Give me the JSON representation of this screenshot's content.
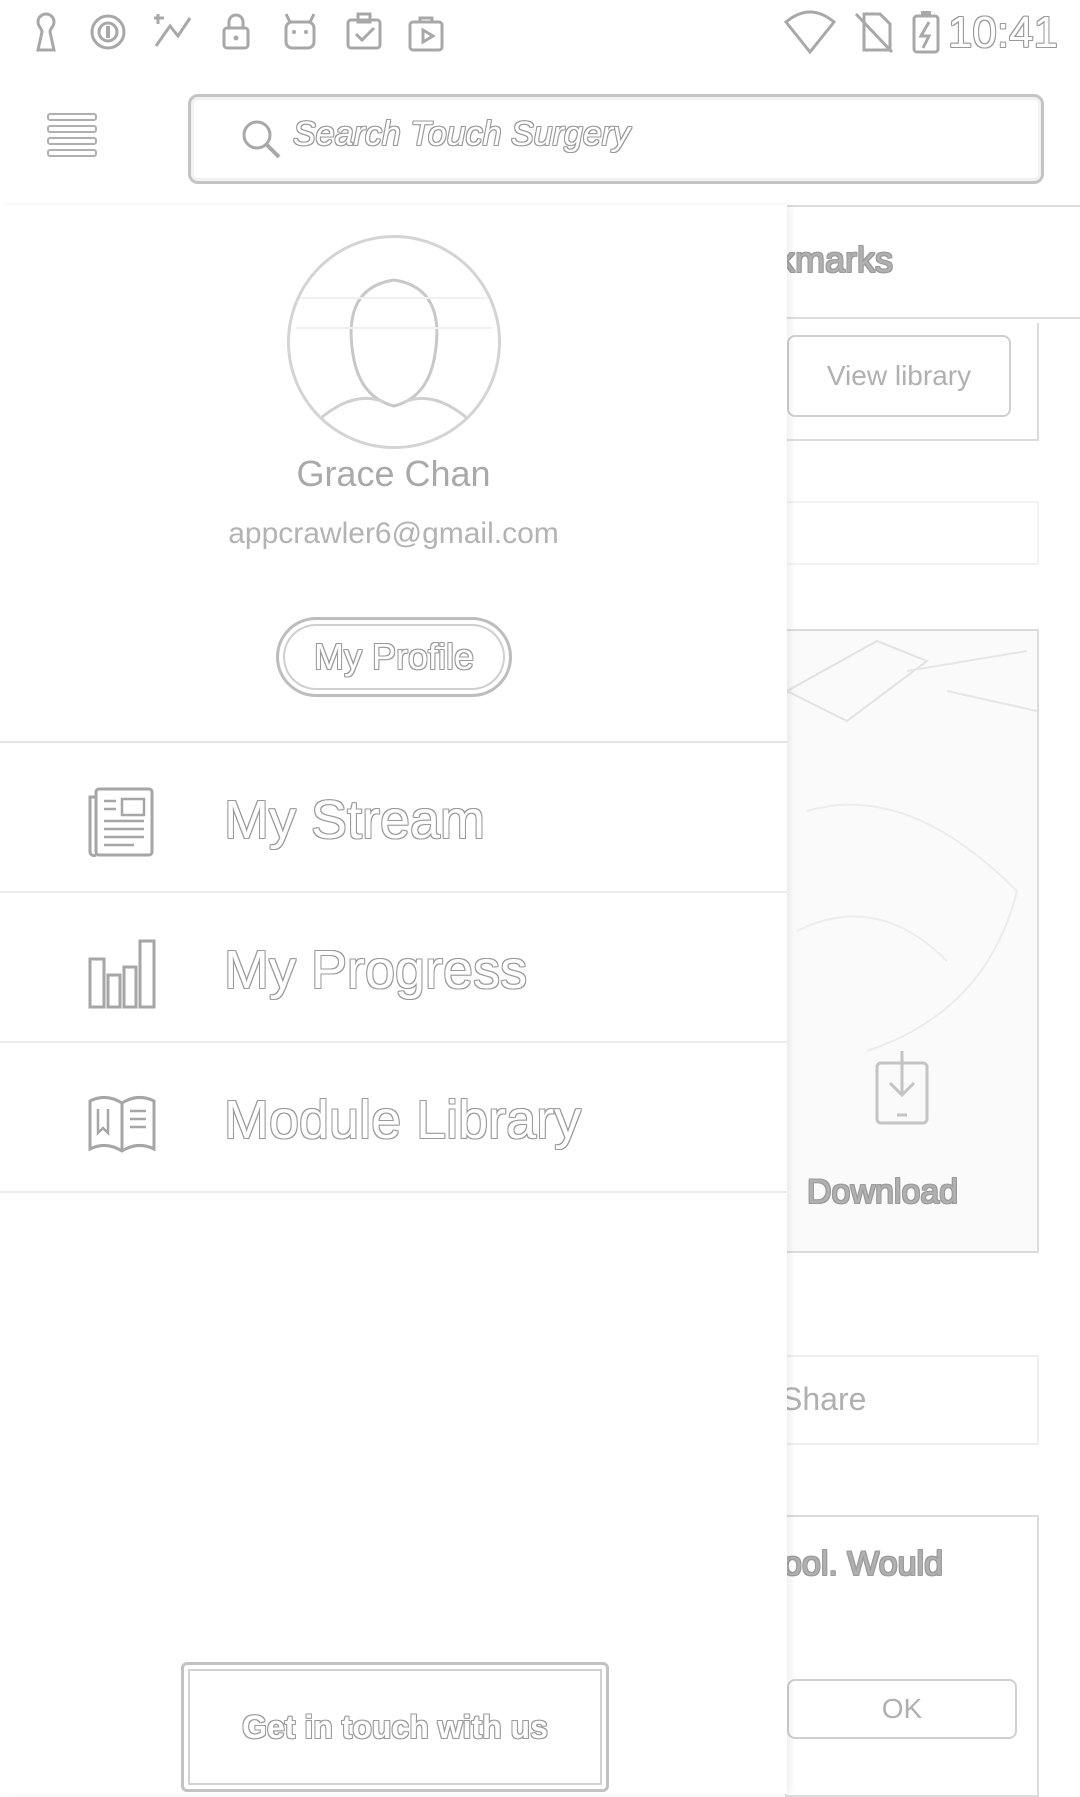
{
  "status_bar": {
    "time": "10:41",
    "left_icons": [
      "keyhole-icon",
      "circle-lock-icon",
      "stats-icon",
      "lock-icon",
      "android-icon",
      "clipboard-check-icon",
      "play-bag-icon"
    ],
    "right_icons": [
      "wifi-icon",
      "no-sim-icon",
      "battery-charging-icon"
    ]
  },
  "header": {
    "search_placeholder": "Search Touch Surgery"
  },
  "drawer": {
    "user_name": "Grace Chan",
    "user_email": "appcrawler6@gmail.com",
    "profile_button": "My Profile",
    "nav_items": [
      {
        "label": "My Stream",
        "icon": "newspaper-icon"
      },
      {
        "label": "My Progress",
        "icon": "bar-chart-icon"
      },
      {
        "label": "Module Library",
        "icon": "open-book-icon"
      }
    ],
    "contact_button": "Get in touch with us"
  },
  "background": {
    "bookmarks_fragment": "kmarks",
    "view_library_button": "View library",
    "download_label": "Download",
    "share_fragment": "Share",
    "dialog_fragment": "ool. Would",
    "ok_button": "OK"
  }
}
